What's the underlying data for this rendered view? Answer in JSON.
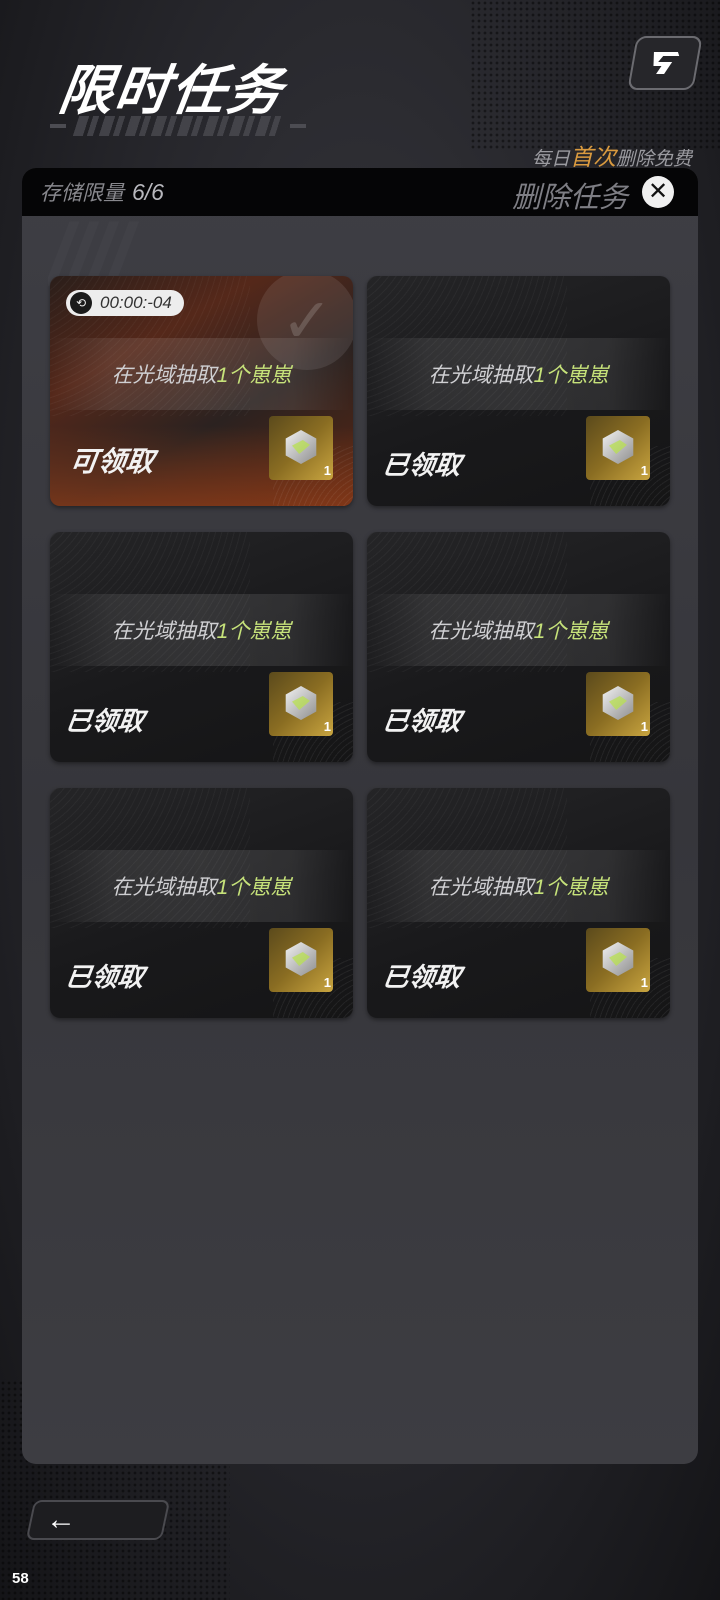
{
  "header": {
    "title": "限时任务",
    "free_hint_prefix": "每日",
    "free_hint_highlight": "首次",
    "free_hint_suffix": "删除免费",
    "corner_icon": "swap-icon"
  },
  "panel": {
    "storage_label": "存储限量",
    "storage_count": "6/6",
    "delete_label": "删除任务",
    "close_icon": "close-x-icon"
  },
  "tasks": [
    {
      "timer": "00:00:-04",
      "text_prefix": "在光域抽取",
      "text_highlight": "1个崽崽",
      "status": "可领取",
      "reward_qty": "1",
      "active": true
    },
    {
      "text_prefix": "在光域抽取",
      "text_highlight": "1个崽崽",
      "status": "已领取",
      "reward_qty": "1",
      "active": false
    },
    {
      "text_prefix": "在光域抽取",
      "text_highlight": "1个崽崽",
      "status": "已领取",
      "reward_qty": "1",
      "active": false
    },
    {
      "text_prefix": "在光域抽取",
      "text_highlight": "1个崽崽",
      "status": "已领取",
      "reward_qty": "1",
      "active": false
    },
    {
      "text_prefix": "在光域抽取",
      "text_highlight": "1个崽崽",
      "status": "已领取",
      "reward_qty": "1",
      "active": false
    },
    {
      "text_prefix": "在光域抽取",
      "text_highlight": "1个崽崽",
      "status": "已领取",
      "reward_qty": "1",
      "active": false
    }
  ],
  "footer": {
    "back_icon": "arrow-left-icon",
    "back_glyph": "←",
    "page_number": "58"
  },
  "colors": {
    "highlight_orange": "#d99a3f",
    "task_green": "#c6e27a",
    "active_card": "#55281a"
  }
}
